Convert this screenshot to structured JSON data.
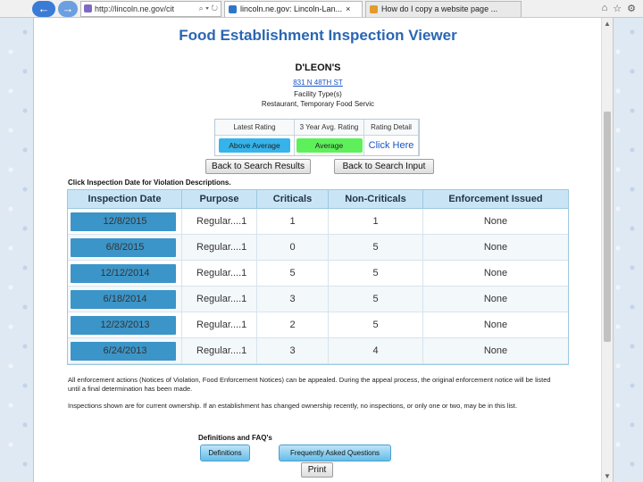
{
  "browser": {
    "address": "http://lincoln.ne.gov/cit",
    "address_tools": "⌕ ▾ ↻",
    "tabs": [
      {
        "label": "lincoln.ne.gov: Lincoln-Lan...",
        "close": "×"
      },
      {
        "label": "How do I copy a website page ..."
      }
    ],
    "window_controls": [
      "⌂",
      "☆",
      "⚙"
    ]
  },
  "page": {
    "title": "Food Establishment Inspection Viewer",
    "establishment": "D'LEON'S",
    "address_link": "831 N 48TH ST",
    "facility_type_label": "Facility Type(s)",
    "facility_type_value": "Restaurant, Temporary Food Servic"
  },
  "rating": {
    "headers": [
      "Latest Rating",
      "3 Year Avg. Rating",
      "Rating Detail"
    ],
    "latest": "Above Average",
    "average": "Average",
    "detail_link": "Click Here",
    "colors": {
      "latest": "#35b3ea",
      "average": "#5ef05a"
    }
  },
  "buttons": {
    "back_results": "Back to Search Results",
    "back_input": "Back to Search Input",
    "definitions": "Definitions",
    "faq": "Frequently Asked Questions",
    "print": "Print"
  },
  "hint": "Click Inspection Date for Violation Descriptions.",
  "table": {
    "headers": [
      "Inspection Date",
      "Purpose",
      "Criticals",
      "Non-Criticals",
      "Enforcement Issued"
    ],
    "rows": [
      {
        "date": "12/8/2015",
        "purpose": "Regular....1",
        "criticals": "1",
        "non_criticals": "1",
        "enforcement": "None"
      },
      {
        "date": "6/8/2015",
        "purpose": "Regular....1",
        "criticals": "0",
        "non_criticals": "5",
        "enforcement": "None"
      },
      {
        "date": "12/12/2014",
        "purpose": "Regular....1",
        "criticals": "5",
        "non_criticals": "5",
        "enforcement": "None"
      },
      {
        "date": "6/18/2014",
        "purpose": "Regular....1",
        "criticals": "3",
        "non_criticals": "5",
        "enforcement": "None"
      },
      {
        "date": "12/23/2013",
        "purpose": "Regular....1",
        "criticals": "2",
        "non_criticals": "5",
        "enforcement": "None"
      },
      {
        "date": "6/24/2013",
        "purpose": "Regular....1",
        "criticals": "3",
        "non_criticals": "4",
        "enforcement": "None"
      }
    ]
  },
  "notes": {
    "appeal": "All enforcement actions (Notices of Violation, Food Enforcement Notices) can be appealed. During the appeal process, the original enforcement notice will be listed until a final determination has been made.",
    "ownership": "Inspections shown are for current ownership. If an establishment has changed ownership recently, no inspections, or only one or two, may be in this list.",
    "defs_label": "Definitions and FAQ's"
  }
}
